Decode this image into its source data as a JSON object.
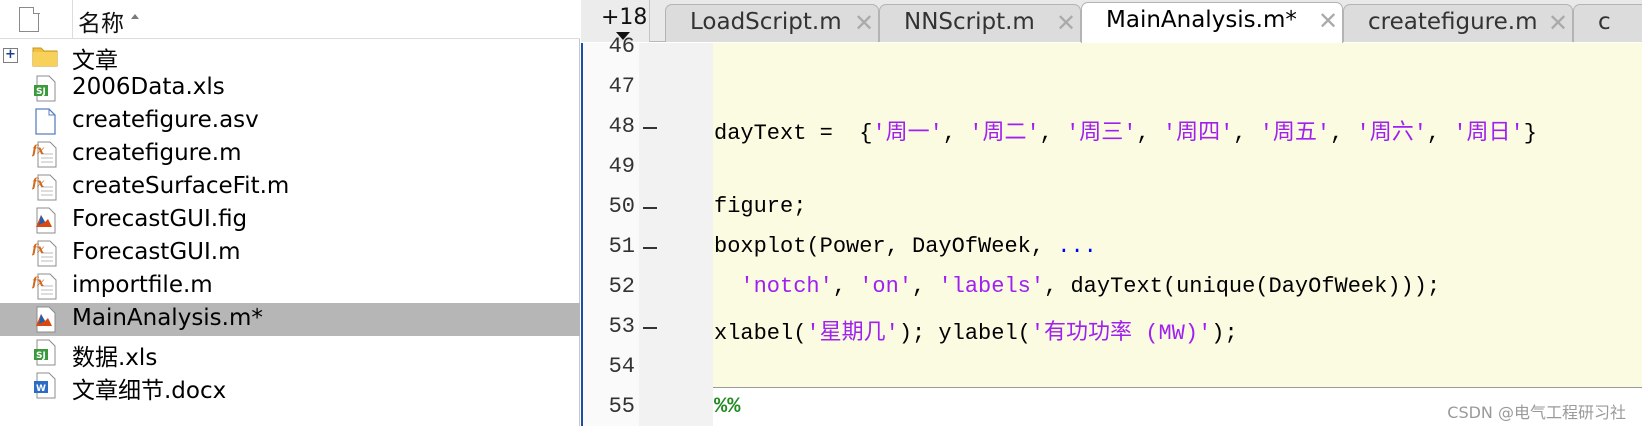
{
  "browser": {
    "header_name": "名称",
    "files": [
      {
        "name": "文章",
        "icon": "folder-icon",
        "expandable": true,
        "selected": false
      },
      {
        "name": "2006Data.xls",
        "icon": "excel-file-icon",
        "selected": false
      },
      {
        "name": "createfigure.asv",
        "icon": "generic-file-icon",
        "selected": false
      },
      {
        "name": "createfigure.m",
        "icon": "matlab-function-icon",
        "selected": false
      },
      {
        "name": "createSurfaceFit.m",
        "icon": "matlab-function-icon",
        "selected": false
      },
      {
        "name": "ForecastGUI.fig",
        "icon": "matlab-figure-icon",
        "selected": false
      },
      {
        "name": "ForecastGUI.m",
        "icon": "matlab-function-icon",
        "selected": false
      },
      {
        "name": "importfile.m",
        "icon": "matlab-function-icon",
        "selected": false
      },
      {
        "name": "MainAnalysis.m*",
        "icon": "matlab-script-icon",
        "selected": true
      },
      {
        "name": "数据.xls",
        "icon": "excel-file-icon",
        "selected": false
      },
      {
        "name": "文章细节.docx",
        "icon": "word-file-icon",
        "selected": false
      }
    ]
  },
  "editor": {
    "tab_overflow": "+18",
    "tabs": [
      {
        "label": "LoadScript.m",
        "active": false
      },
      {
        "label": "NNScript.m",
        "active": false
      },
      {
        "label": "MainAnalysis.m*",
        "active": true
      },
      {
        "label": "createfigure.m",
        "active": false
      },
      {
        "label": "c",
        "active": false
      }
    ],
    "line_numbers": [
      "46",
      "47",
      "48",
      "49",
      "50",
      "51",
      "52",
      "53",
      "54",
      "55"
    ],
    "code": {
      "l48_a": "dayText = ",
      "l48_b": "{",
      "l48_s1": "'周一'",
      "l48_s2": "'周二'",
      "l48_s3": "'周三'",
      "l48_s4": "'周四'",
      "l48_s5": "'周五'",
      "l48_s6": "'周六'",
      "l48_s7": "'周日'",
      "l48_c": "}",
      "l50": "figure;",
      "l51_a": "boxplot(Power, DayOfWeek, ",
      "l51_dots": "...",
      "l52_s1": "'notch'",
      "l52_s2": "'on'",
      "l52_s3": "'labels'",
      "l52_b": ", dayText(unique(DayOfWeek)));",
      "l53_a": "xlabel(",
      "l53_s1": "'星期几'",
      "l53_b": "); ylabel(",
      "l53_s2": "'有功功率 (MW)'",
      "l53_c": ");",
      "l55": "%%"
    },
    "watermark": "CSDN @电气工程研习社"
  }
}
